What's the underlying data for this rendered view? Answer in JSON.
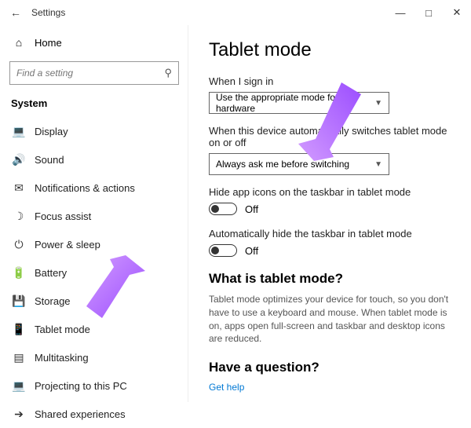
{
  "titlebar": {
    "title": "Settings"
  },
  "sidebar": {
    "home": "Home",
    "search_placeholder": "Find a setting",
    "category": "System",
    "items": [
      {
        "icon": "display",
        "label": "Display"
      },
      {
        "icon": "sound",
        "label": "Sound"
      },
      {
        "icon": "notify",
        "label": "Notifications & actions"
      },
      {
        "icon": "focus",
        "label": "Focus assist"
      },
      {
        "icon": "power",
        "label": "Power & sleep"
      },
      {
        "icon": "battery",
        "label": "Battery"
      },
      {
        "icon": "storage",
        "label": "Storage"
      },
      {
        "icon": "tablet",
        "label": "Tablet mode"
      },
      {
        "icon": "multitask",
        "label": "Multitasking"
      },
      {
        "icon": "project",
        "label": "Projecting to this PC"
      },
      {
        "icon": "shared",
        "label": "Shared experiences"
      }
    ]
  },
  "main": {
    "heading": "Tablet mode",
    "signin_label": "When I sign in",
    "signin_value": "Use the appropriate mode for my hardware",
    "switch_label": "When this device automatically switches tablet mode on or off",
    "switch_value": "Always ask me before switching",
    "hide_icons_label": "Hide app icons on the taskbar in tablet mode",
    "hide_icons_state": "Off",
    "auto_hide_label": "Automatically hide the taskbar in tablet mode",
    "auto_hide_state": "Off",
    "what_heading": "What is tablet mode?",
    "what_desc": "Tablet mode optimizes your device for touch, so you don't have to use a keyboard and mouse. When tablet mode is on, apps open full-screen and taskbar and desktop icons are reduced.",
    "question_heading": "Have a question?",
    "help_link": "Get help"
  }
}
